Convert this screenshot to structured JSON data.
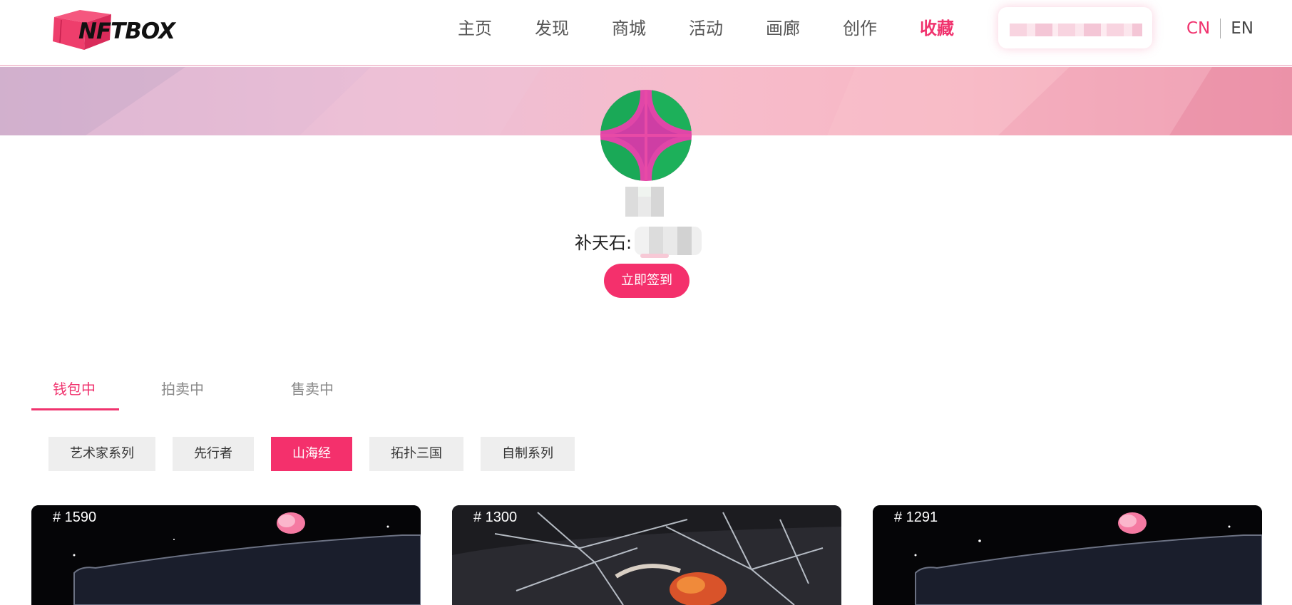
{
  "header": {
    "logo_text": "NFTBOX",
    "nav": [
      {
        "label": "主页",
        "active": false
      },
      {
        "label": "发现",
        "active": false
      },
      {
        "label": "商城",
        "active": false
      },
      {
        "label": "活动",
        "active": false
      },
      {
        "label": "画廊",
        "active": false
      },
      {
        "label": "创作",
        "active": false
      },
      {
        "label": "收藏",
        "active": true
      }
    ],
    "lang_cn": "CN",
    "lang_en": "EN"
  },
  "profile": {
    "stone_label": "补天石:",
    "signin_label": "立即签到"
  },
  "tabs": [
    {
      "label": "钱包中",
      "active": true
    },
    {
      "label": "拍卖中",
      "active": false
    },
    {
      "label": "售卖中",
      "active": false
    }
  ],
  "categories": [
    {
      "label": "艺术家系列",
      "active": false
    },
    {
      "label": "先行者",
      "active": false
    },
    {
      "label": "山海经",
      "active": true
    },
    {
      "label": "拓扑三国",
      "active": false
    },
    {
      "label": "自制系列",
      "active": false
    }
  ],
  "cards": [
    {
      "number": "# 1590"
    },
    {
      "number": "# 1300"
    },
    {
      "number": "# 1291"
    }
  ],
  "colors": {
    "accent": "#f4306c",
    "nav_active": "#f0336e"
  }
}
